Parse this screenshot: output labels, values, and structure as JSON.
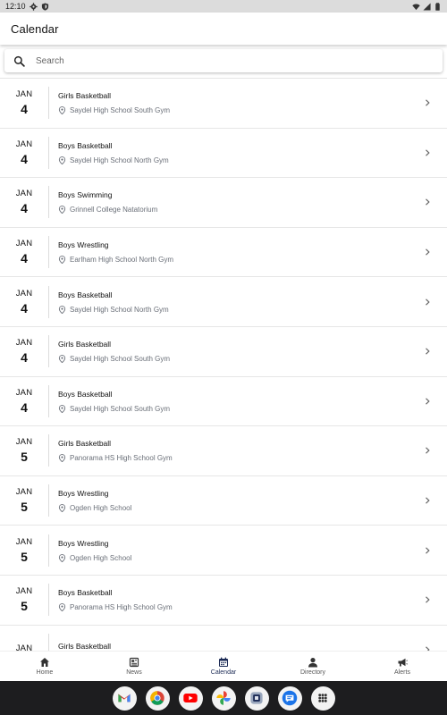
{
  "status_bar": {
    "time": "12:10"
  },
  "app_bar": {
    "title": "Calendar"
  },
  "search": {
    "placeholder": "Search"
  },
  "events": [
    {
      "month": "JAN",
      "day": "4",
      "name": "Girls Basketball",
      "location": "Saydel High School South Gym"
    },
    {
      "month": "JAN",
      "day": "4",
      "name": "Boys Basketball",
      "location": "Saydel High School North Gym"
    },
    {
      "month": "JAN",
      "day": "4",
      "name": "Boys Swimming",
      "location": "Grinnell College Natatorium"
    },
    {
      "month": "JAN",
      "day": "4",
      "name": "Boys Wrestling",
      "location": "Earlham High School North Gym"
    },
    {
      "month": "JAN",
      "day": "4",
      "name": "Boys Basketball",
      "location": "Saydel High School North Gym"
    },
    {
      "month": "JAN",
      "day": "4",
      "name": "Girls Basketball",
      "location": "Saydel High School South Gym"
    },
    {
      "month": "JAN",
      "day": "4",
      "name": "Boys Basketball",
      "location": "Saydel High School South Gym"
    },
    {
      "month": "JAN",
      "day": "5",
      "name": "Girls Basketball",
      "location": "Panorama HS High School Gym"
    },
    {
      "month": "JAN",
      "day": "5",
      "name": "Boys Wrestling",
      "location": "Ogden High School"
    },
    {
      "month": "JAN",
      "day": "5",
      "name": "Boys Wrestling",
      "location": "Ogden High School"
    },
    {
      "month": "JAN",
      "day": "5",
      "name": "Boys Basketball",
      "location": "Panorama HS High School Gym"
    },
    {
      "month": "JAN",
      "day": "",
      "name": "Girls Basketball",
      "location": ""
    }
  ],
  "bottom_nav": [
    {
      "label": "Home",
      "icon": "home-icon",
      "active": false
    },
    {
      "label": "News",
      "icon": "news-icon",
      "active": false
    },
    {
      "label": "Calendar",
      "icon": "calendar-icon",
      "active": true
    },
    {
      "label": "Directory",
      "icon": "person-icon",
      "active": false
    },
    {
      "label": "Alerts",
      "icon": "megaphone-icon",
      "active": false
    }
  ],
  "dock": [
    {
      "icon": "gmail-icon"
    },
    {
      "icon": "chrome-icon"
    },
    {
      "icon": "youtube-icon"
    },
    {
      "icon": "photos-icon"
    },
    {
      "icon": "school-app-icon"
    },
    {
      "icon": "messages-icon"
    },
    {
      "icon": "app-drawer-icon"
    }
  ],
  "colors": {
    "accent": "#1b2a55",
    "divider": "#e6e6e6",
    "location_text": "#6a6f78"
  }
}
